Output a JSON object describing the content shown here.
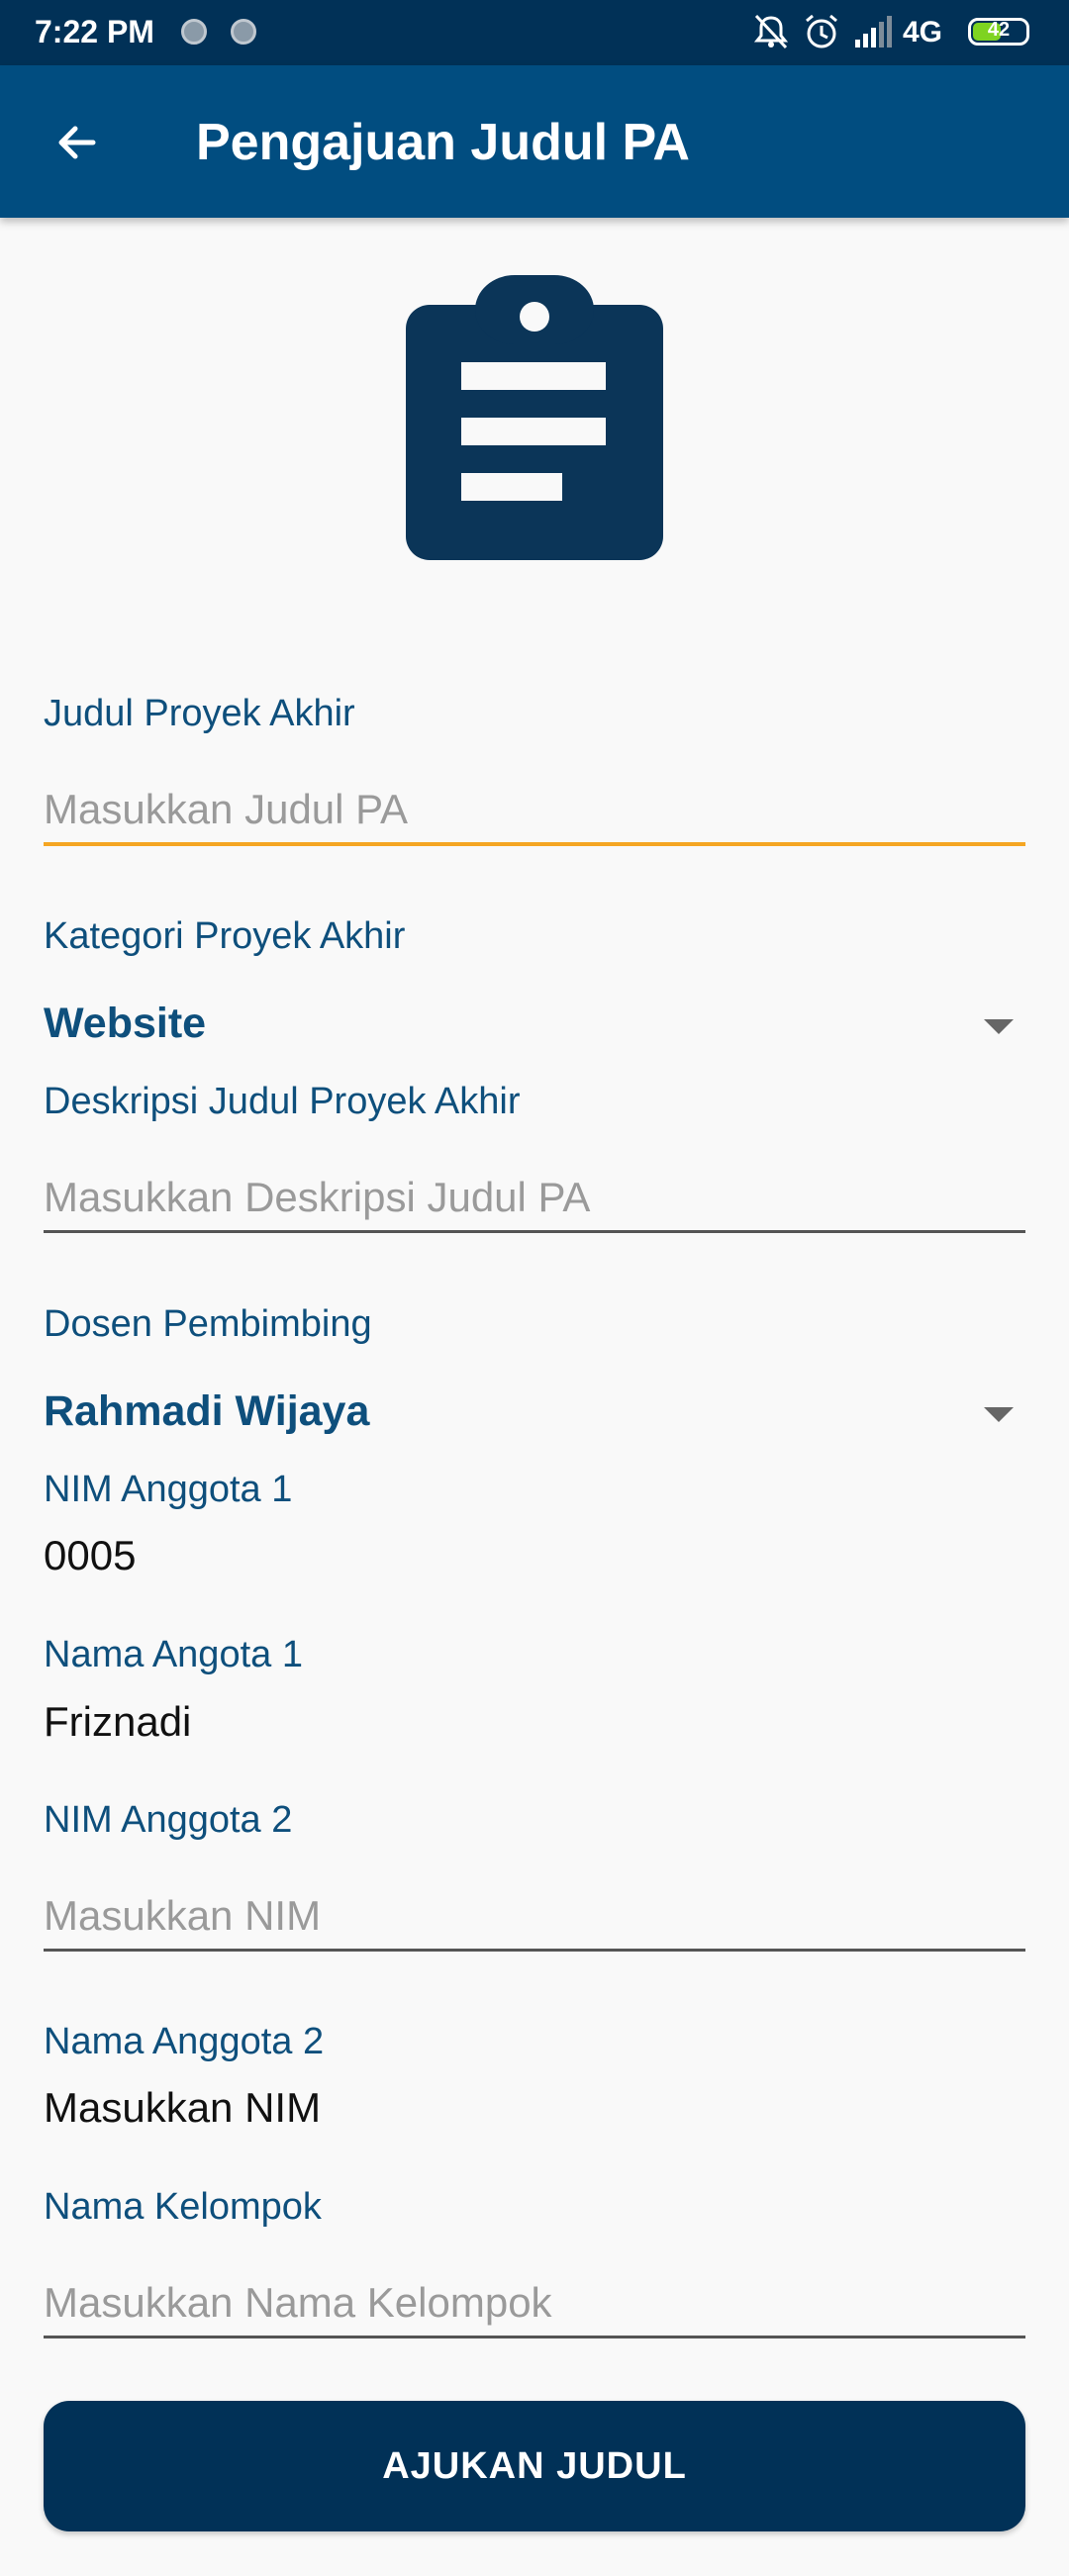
{
  "status_bar": {
    "time": "7:22 PM",
    "network": "4G",
    "battery": "42"
  },
  "app_bar": {
    "title": "Pengajuan Judul PA",
    "back_icon": "arrow-left-icon"
  },
  "header_icon": "clipboard-icon",
  "form": {
    "judul": {
      "label": "Judul Proyek Akhir",
      "placeholder": "Masukkan Judul PA",
      "value": ""
    },
    "kategori": {
      "label": "Kategori Proyek Akhir",
      "selected": "Website"
    },
    "deskripsi": {
      "label": "Deskripsi Judul Proyek Akhir",
      "placeholder": "Masukkan Deskripsi Judul PA",
      "value": ""
    },
    "dosen": {
      "label": "Dosen Pembimbing",
      "selected": "Rahmadi Wijaya"
    },
    "nim1": {
      "label": "NIM Anggota 1",
      "value": "0005"
    },
    "nama1": {
      "label": "Nama Angota 1",
      "value": "Friznadi"
    },
    "nim2": {
      "label": "NIM Anggota 2",
      "placeholder": "Masukkan NIM",
      "value": ""
    },
    "nama2": {
      "label": "Nama Anggota 2",
      "value": "Masukkan NIM"
    },
    "kelompok": {
      "label": "Nama Kelompok",
      "placeholder": "Masukkan Nama Kelompok",
      "value": ""
    }
  },
  "submit_label": "AJUKAN JUDUL",
  "colors": {
    "status_bar": "#013157",
    "app_bar": "#014d80",
    "label": "#0e4f7c",
    "focus_underline": "#f5a623",
    "button": "#013157"
  }
}
